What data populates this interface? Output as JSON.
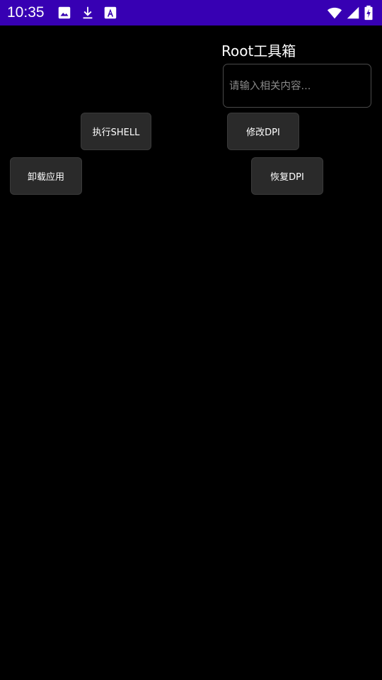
{
  "status_bar": {
    "time": "10:35",
    "background": "#3700B3",
    "left_icons": [
      "image-icon",
      "download-icon",
      "text-a-icon"
    ],
    "right_icons": [
      "wifi-icon",
      "signal-icon",
      "battery-charging-icon"
    ]
  },
  "main": {
    "title": "Root工具箱",
    "input_placeholder": "请输入相关内容...",
    "input_value": "",
    "buttons": {
      "execute_shell": "执行SHELL",
      "modify_dpi": "修改DPI",
      "uninstall_app": "卸载应用",
      "restore_dpi": "恢复DPI"
    }
  }
}
